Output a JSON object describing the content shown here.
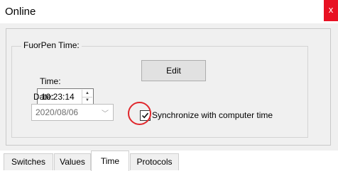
{
  "window": {
    "title": "Online",
    "close_label": "x"
  },
  "group": {
    "label": "FuorPen Time:",
    "time_label": "Time:",
    "time_value": "10:23:14",
    "date_label": "Date:",
    "date_value": "2020/08/06",
    "edit_label": "Edit",
    "sync_label": "Synchronize with computer time",
    "sync_checked": true
  },
  "tabs": [
    {
      "label": "Switches"
    },
    {
      "label": "Values"
    },
    {
      "label": "Time",
      "active": true
    },
    {
      "label": "Protocols"
    }
  ],
  "colors": {
    "close": "#e81123",
    "highlight_circle": "#e0262b"
  }
}
